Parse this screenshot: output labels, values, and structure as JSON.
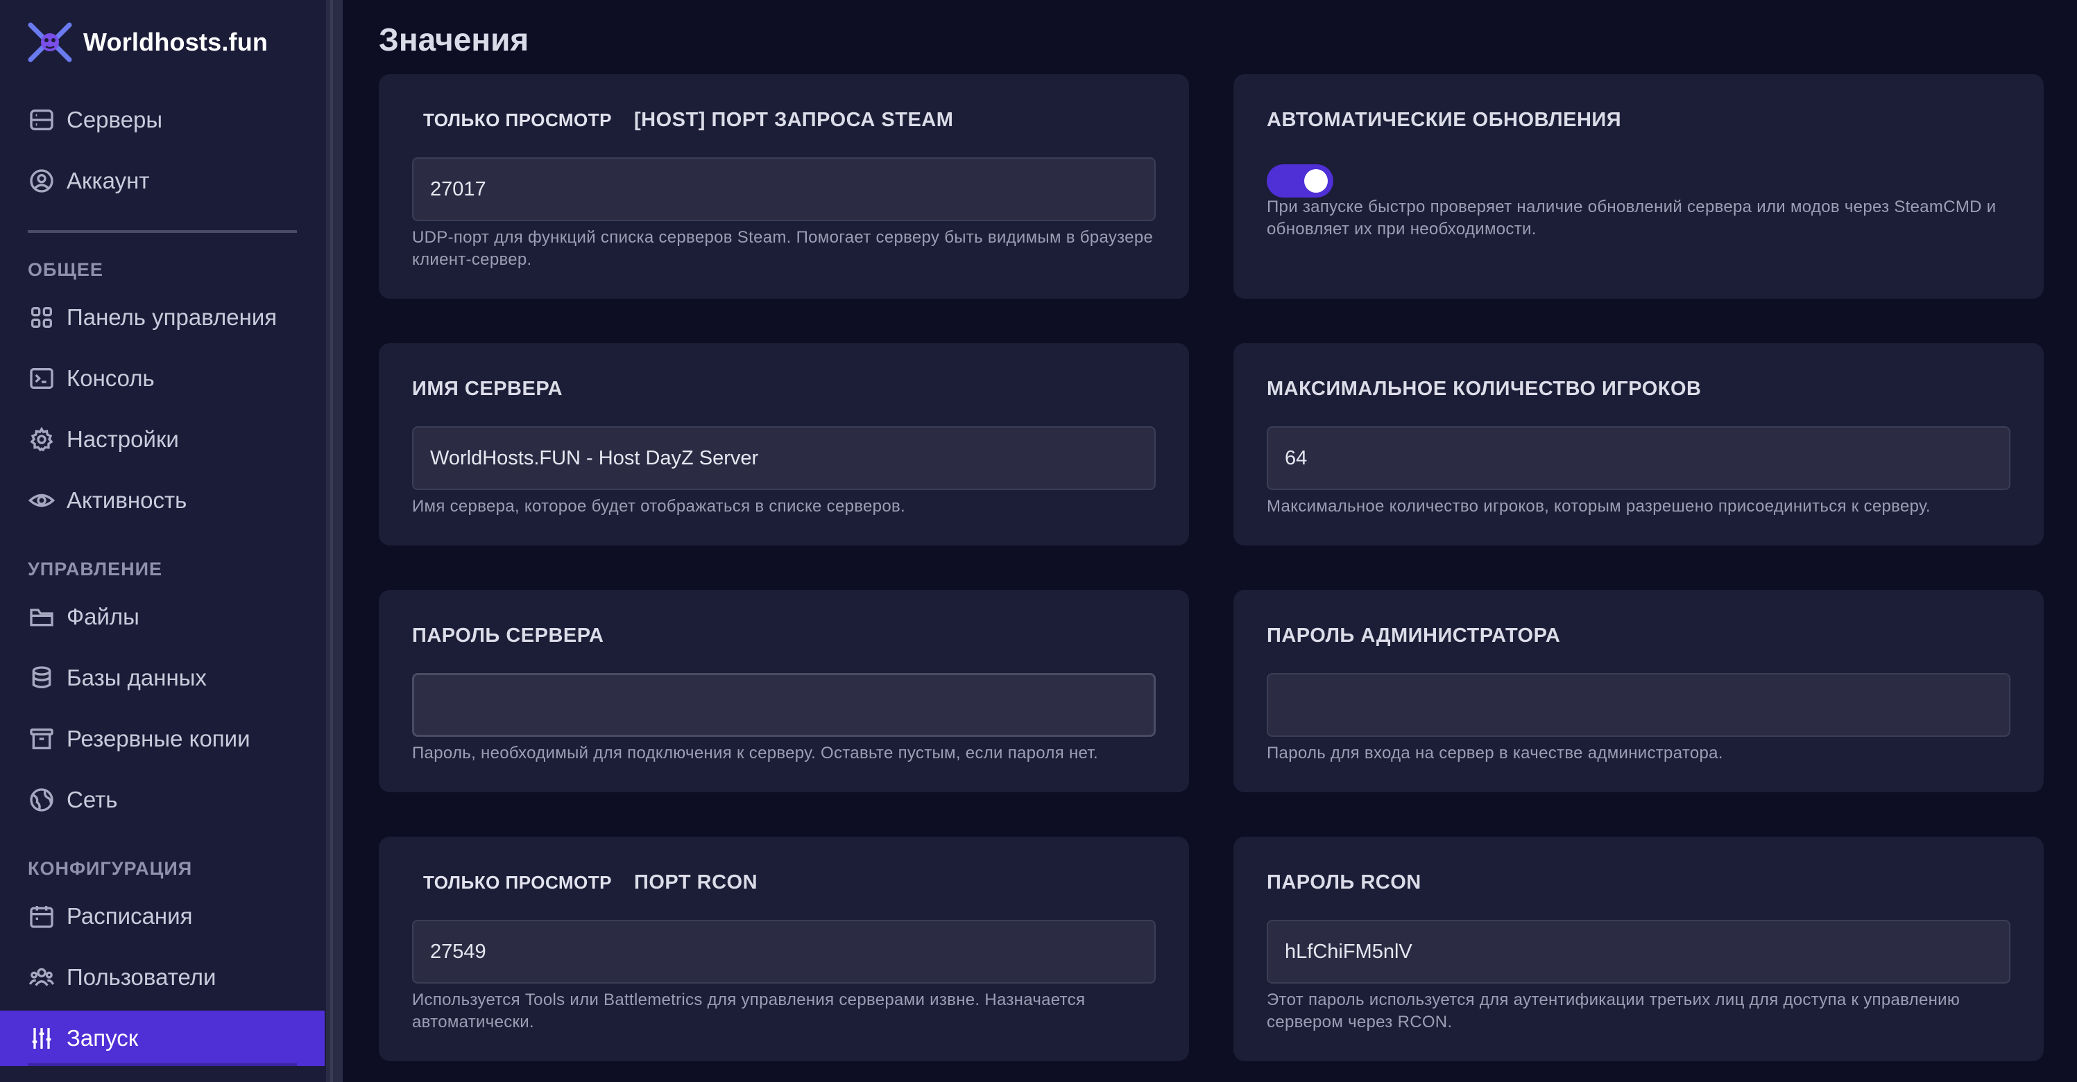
{
  "brand": {
    "name": "Worldhosts.fun"
  },
  "sidebar": {
    "top_items": [
      {
        "label": "Серверы",
        "icon": "server-icon"
      },
      {
        "label": "Аккаунт",
        "icon": "user-circle-icon"
      }
    ],
    "sections": [
      {
        "title": "ОБЩЕЕ"
      },
      {
        "title": "УПРАВЛЕНИЕ"
      },
      {
        "title": "КОНФИГУРАЦИЯ"
      }
    ],
    "general": [
      {
        "label": "Панель управления",
        "icon": "dashboard-grid-icon"
      },
      {
        "label": "Консоль",
        "icon": "terminal-icon"
      },
      {
        "label": "Настройки",
        "icon": "gear-icon"
      },
      {
        "label": "Активность",
        "icon": "eye-icon"
      }
    ],
    "management": [
      {
        "label": "Файлы",
        "icon": "folder-icon"
      },
      {
        "label": "Базы данных",
        "icon": "database-icon"
      },
      {
        "label": "Резервные копии",
        "icon": "archive-icon"
      },
      {
        "label": "Сеть",
        "icon": "globe-icon"
      }
    ],
    "configuration": [
      {
        "label": "Расписания",
        "icon": "calendar-icon"
      },
      {
        "label": "Пользователи",
        "icon": "users-icon"
      },
      {
        "label": "Запуск",
        "icon": "sliders-icon",
        "active": true
      }
    ]
  },
  "page": {
    "title": "Значения"
  },
  "cards": {
    "steam_port": {
      "badge": "ТОЛЬКО ПРОСМОТР",
      "label": "[HOST] ПОРТ ЗАПРОСА STEAM",
      "value": "27017",
      "help": "UDP-порт для функций списка серверов Steam. Помогает серверу быть видимым в браузере клиент-сервер."
    },
    "auto_updates": {
      "label": "АВТОМАТИЧЕСКИЕ ОБНОВЛЕНИЯ",
      "enabled": true,
      "help": "При запуске быстро проверяет наличие обновлений сервера или модов через SteamCMD и обновляет их при необходимости."
    },
    "server_name": {
      "label": "ИМЯ СЕРВЕРА",
      "value": "WorldHosts.FUN - Host DayZ Server",
      "help": "Имя сервера, которое будет отображаться в списке серверов."
    },
    "max_players": {
      "label": "МАКСИМАЛЬНОЕ КОЛИЧЕСТВО ИГРОКОВ",
      "value": "64",
      "help": "Максимальное количество игроков, которым разрешено присоединиться к серверу."
    },
    "server_password": {
      "label": "ПАРОЛЬ СЕРВЕРА",
      "value": "",
      "help": "Пароль, необходимый для подключения к серверу. Оставьте пустым, если пароля нет."
    },
    "admin_password": {
      "label": "ПАРОЛЬ АДМИНИСТРАТОРА",
      "value": "",
      "help": "Пароль для входа на сервер в качестве администратора."
    },
    "rcon_port": {
      "badge": "ТОЛЬКО ПРОСМОТР",
      "label": "ПОРТ RCON",
      "value": "27549",
      "help": "Используется Tools или Battlemetrics для управления серверами извне. Назначается автоматически."
    },
    "rcon_password": {
      "label": "ПАРОЛЬ RCON",
      "value": "hLfChiFM5nlV",
      "help": "Этот пароль используется для аутентификации третьих лиц для доступа к управлению сервером через RCON."
    }
  },
  "colors": {
    "accent": "#4f2fd6",
    "background": "#0d0e24",
    "sidebar": "#1b1c38",
    "card": "#1c1d36"
  }
}
